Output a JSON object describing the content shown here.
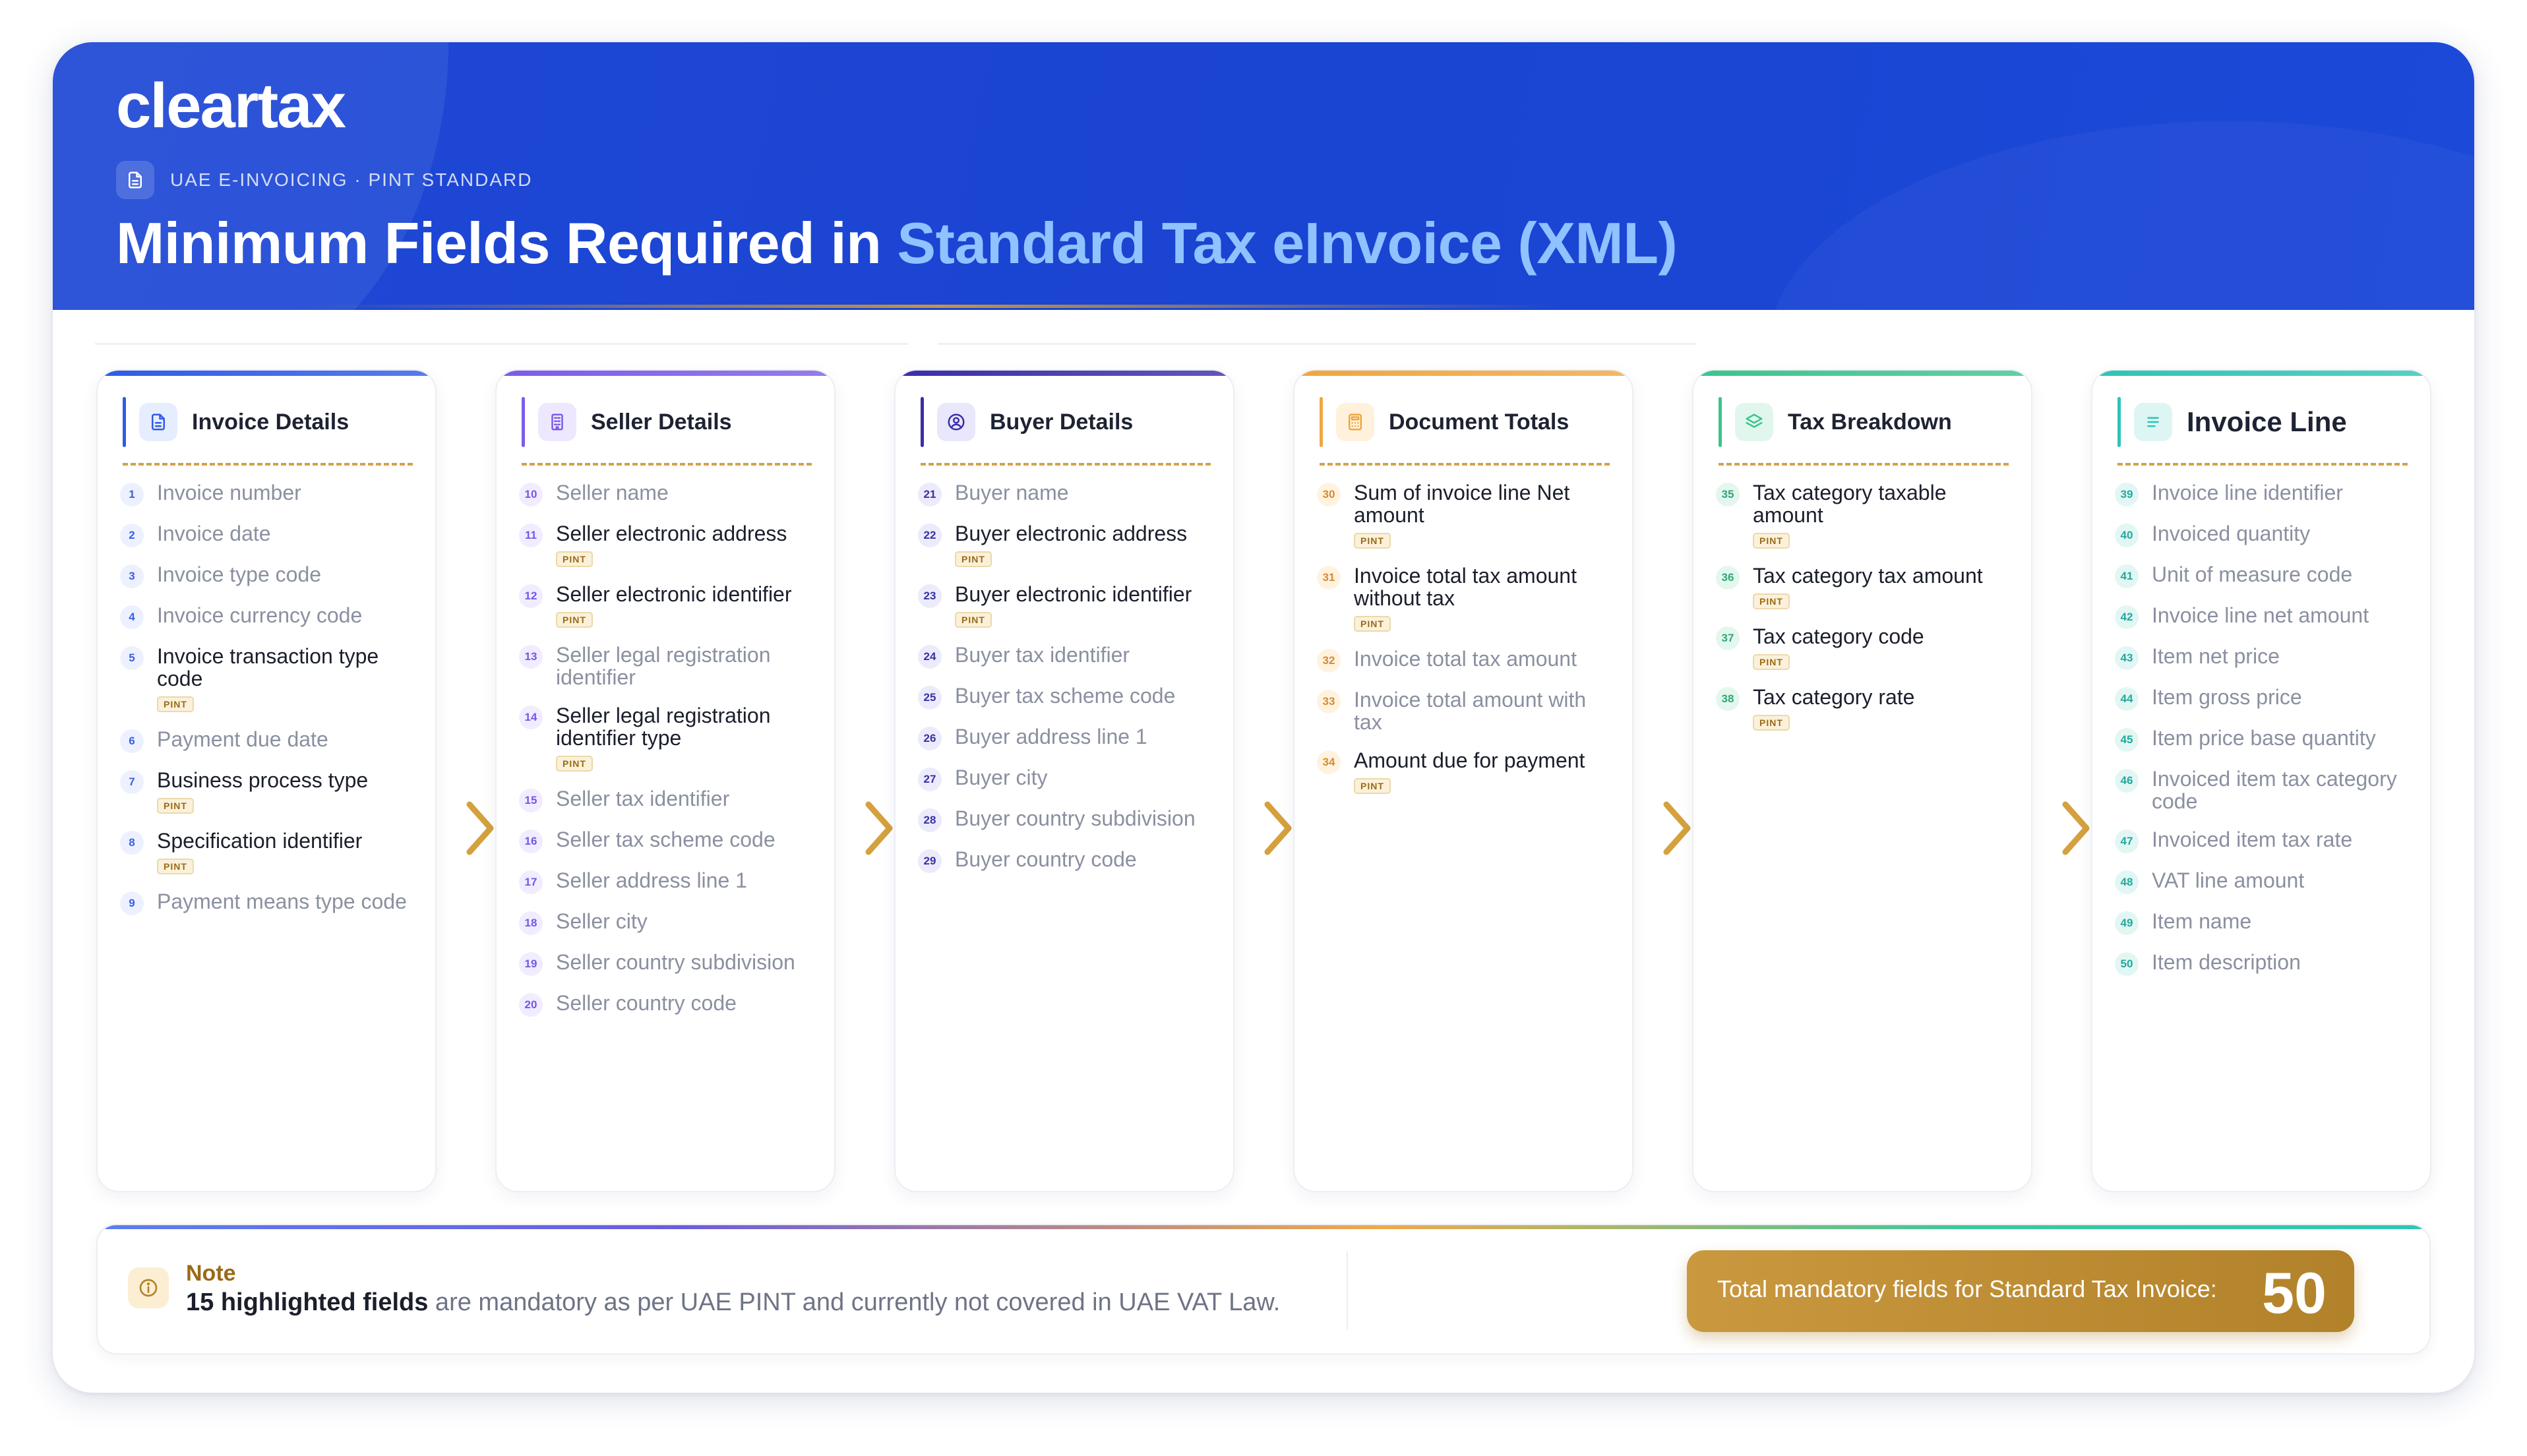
{
  "header": {
    "brand": "cleartax",
    "kicker": "UAE E-INVOICING · PINT STANDARD",
    "title_main": "Minimum Fields Required in ",
    "title_accent": "Standard Tax eInvoice (XML)",
    "kicker_icon": "document-icon"
  },
  "colors": {
    "header_blue": "#1f48d6",
    "title_accent": "#8fc2ff",
    "gold": "#c7963a",
    "invoice_details": "#2f5be6",
    "seller_details": "#7b5ce8",
    "buyer_details": "#3a2ea8",
    "document_totals": "#f0a63f",
    "tax_breakdown": "#3cc48d",
    "invoice_line": "#2ec4b6"
  },
  "pint_badge": "PINT",
  "sections": [
    {
      "title": "Invoice Details",
      "icon": "document-icon",
      "fields": [
        {
          "num": "1",
          "label": "Invoice number",
          "pint": false
        },
        {
          "num": "2",
          "label": "Invoice date",
          "pint": false
        },
        {
          "num": "3",
          "label": "Invoice type code",
          "pint": false
        },
        {
          "num": "4",
          "label": "Invoice currency code",
          "pint": false
        },
        {
          "num": "5",
          "label": "Invoice transaction type code",
          "pint": true
        },
        {
          "num": "6",
          "label": "Payment due date",
          "pint": false
        },
        {
          "num": "7",
          "label": "Business process type",
          "pint": true
        },
        {
          "num": "8",
          "label": "Specification identifier",
          "pint": true
        },
        {
          "num": "9",
          "label": "Payment means type code",
          "pint": false
        }
      ]
    },
    {
      "title": "Seller Details",
      "icon": "building-icon",
      "fields": [
        {
          "num": "10",
          "label": "Seller name",
          "pint": false
        },
        {
          "num": "11",
          "label": "Seller electronic address",
          "pint": true
        },
        {
          "num": "12",
          "label": "Seller electronic identifier",
          "pint": true
        },
        {
          "num": "13",
          "label": "Seller legal registration identifier",
          "pint": false
        },
        {
          "num": "14",
          "label": "Seller legal registration identifier type",
          "pint": true
        },
        {
          "num": "15",
          "label": "Seller tax identifier",
          "pint": false
        },
        {
          "num": "16",
          "label": "Seller tax scheme code",
          "pint": false
        },
        {
          "num": "17",
          "label": "Seller address line 1",
          "pint": false
        },
        {
          "num": "18",
          "label": "Seller city",
          "pint": false
        },
        {
          "num": "19",
          "label": "Seller country subdivision",
          "pint": false
        },
        {
          "num": "20",
          "label": "Seller country code",
          "pint": false
        }
      ]
    },
    {
      "title": "Buyer Details",
      "icon": "user-icon",
      "fields": [
        {
          "num": "21",
          "label": "Buyer name",
          "pint": false
        },
        {
          "num": "22",
          "label": "Buyer electronic address",
          "pint": true
        },
        {
          "num": "23",
          "label": "Buyer electronic identifier",
          "pint": true
        },
        {
          "num": "24",
          "label": "Buyer tax identifier",
          "pint": false
        },
        {
          "num": "25",
          "label": "Buyer tax scheme code",
          "pint": false
        },
        {
          "num": "26",
          "label": "Buyer address line 1",
          "pint": false
        },
        {
          "num": "27",
          "label": "Buyer city",
          "pint": false
        },
        {
          "num": "28",
          "label": "Buyer country subdivision",
          "pint": false
        },
        {
          "num": "29",
          "label": "Buyer country code",
          "pint": false
        }
      ]
    },
    {
      "title": "Document Totals",
      "icon": "calculator-icon",
      "fields": [
        {
          "num": "30",
          "label": "Sum of invoice line Net amount",
          "pint": true
        },
        {
          "num": "31",
          "label": "Invoice total tax amount without tax",
          "pint": true
        },
        {
          "num": "32",
          "label": "Invoice total tax amount",
          "pint": false
        },
        {
          "num": "33",
          "label": "Invoice total amount with tax",
          "pint": false
        },
        {
          "num": "34",
          "label": "Amount due for payment",
          "pint": true
        }
      ]
    },
    {
      "title": "Tax Breakdown",
      "icon": "layers-icon",
      "fields": [
        {
          "num": "35",
          "label": "Tax category taxable amount",
          "pint": true
        },
        {
          "num": "36",
          "label": "Tax category tax amount",
          "pint": true
        },
        {
          "num": "37",
          "label": "Tax category code",
          "pint": true
        },
        {
          "num": "38",
          "label": "Tax category rate",
          "pint": true
        }
      ]
    },
    {
      "title": "Invoice Line",
      "icon": "list-icon",
      "fields": [
        {
          "num": "39",
          "label": "Invoice line identifier",
          "pint": false
        },
        {
          "num": "40",
          "label": "Invoiced quantity",
          "pint": false
        },
        {
          "num": "41",
          "label": "Unit of measure code",
          "pint": false
        },
        {
          "num": "42",
          "label": "Invoice line net amount",
          "pint": false
        },
        {
          "num": "43",
          "label": "Item net price",
          "pint": false
        },
        {
          "num": "44",
          "label": "Item gross price",
          "pint": false
        },
        {
          "num": "45",
          "label": "Item price base quantity",
          "pint": false
        },
        {
          "num": "46",
          "label": "Invoiced item tax category code",
          "pint": false
        },
        {
          "num": "47",
          "label": "Invoiced item tax rate",
          "pint": false
        },
        {
          "num": "48",
          "label": "VAT line amount",
          "pint": false
        },
        {
          "num": "49",
          "label": "Item name",
          "pint": false
        },
        {
          "num": "50",
          "label": "Item description",
          "pint": false
        }
      ]
    }
  ],
  "note": {
    "title": "Note",
    "bold": "15 highlighted fields",
    "text": " are mandatory as per UAE PINT and currently not covered in UAE VAT Law.",
    "icon": "info-icon"
  },
  "total": {
    "label": "Total mandatory fields for Standard Tax Invoice:",
    "value": "50"
  }
}
